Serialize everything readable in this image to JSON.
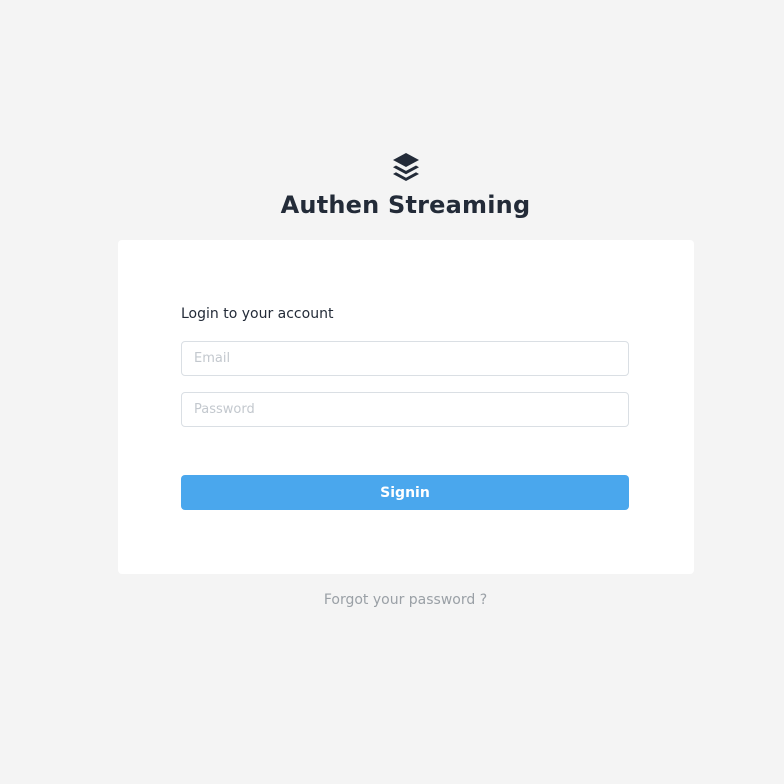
{
  "brand": {
    "icon": "layers-icon",
    "title": "Authen Streaming"
  },
  "login_form": {
    "heading": "Login to your account",
    "email": {
      "value": "",
      "placeholder": "Email"
    },
    "password": {
      "value": "",
      "placeholder": "Password"
    },
    "signin_label": "Signin"
  },
  "forgot_password_label": "Forgot your password ?",
  "colors": {
    "background": "#f4f4f4",
    "card": "#ffffff",
    "primary_button": "#4aa7ed",
    "text_dark": "#232b38",
    "text_muted": "#9aa0a6",
    "input_border": "#dadfe4"
  }
}
